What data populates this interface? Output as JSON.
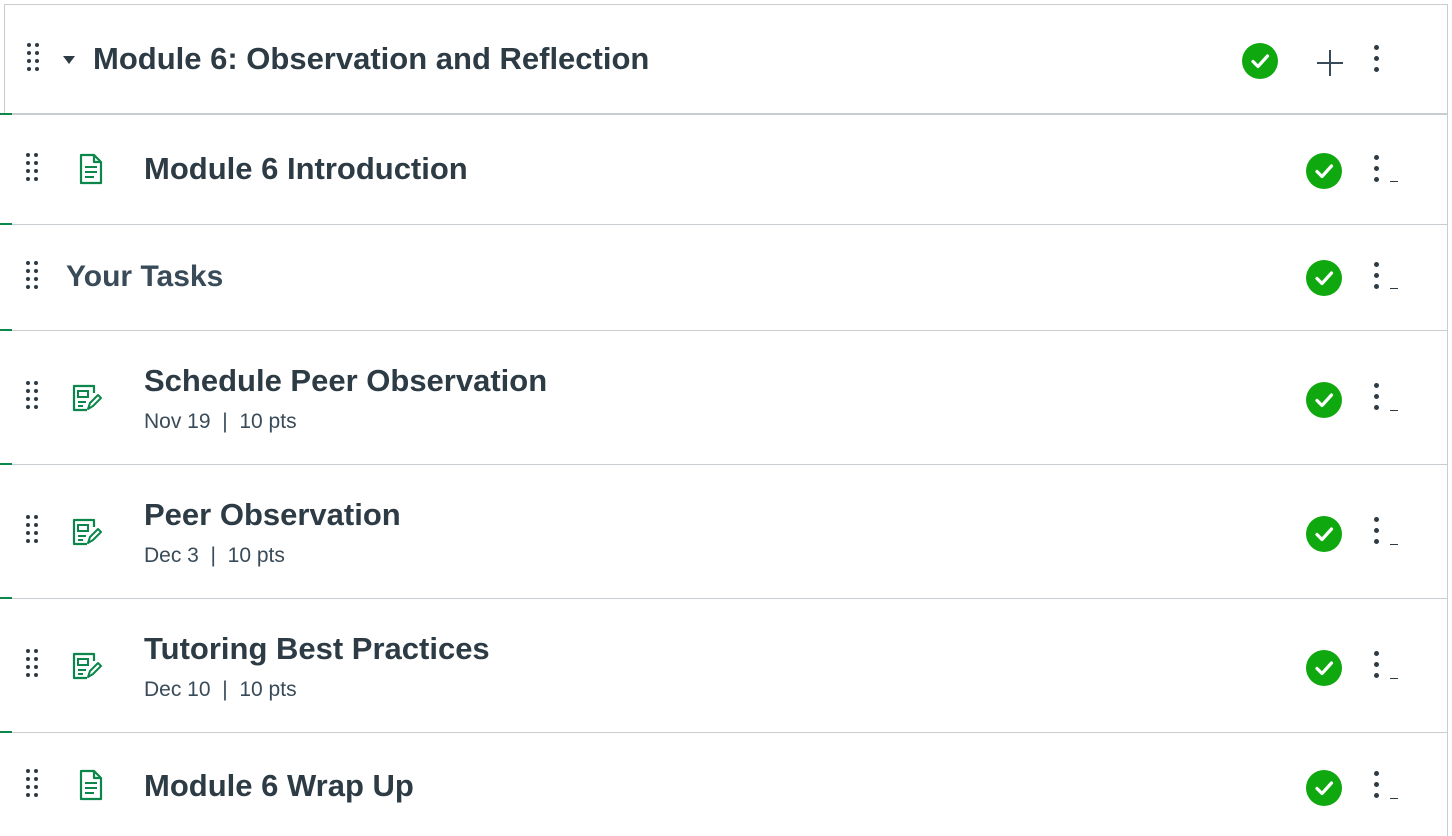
{
  "module": {
    "title": "Module 6: Observation and Reflection",
    "status": "published",
    "add_icon": "plus-icon",
    "menu_icon": "kebab-icon"
  },
  "items": [
    {
      "type": "page",
      "icon": "document-icon",
      "title": "Module 6 Introduction",
      "status": "published"
    },
    {
      "type": "subheader",
      "title": "Your Tasks",
      "status": "published"
    },
    {
      "type": "assignment",
      "icon": "assignment-icon",
      "title": "Schedule Peer Observation",
      "due": "Nov 19",
      "separator": "|",
      "points": "10 pts",
      "status": "published"
    },
    {
      "type": "assignment",
      "icon": "assignment-icon",
      "title": "Peer Observation",
      "due": "Dec 3",
      "separator": "|",
      "points": "10 pts",
      "status": "published"
    },
    {
      "type": "assignment",
      "icon": "assignment-icon",
      "title": "Tutoring Best Practices",
      "due": "Dec 10",
      "separator": "|",
      "points": "10 pts",
      "status": "published"
    },
    {
      "type": "page",
      "icon": "document-icon",
      "title": "Module 6 Wrap Up",
      "status": "published"
    }
  ],
  "colors": {
    "published_green": "#0fa80f",
    "icon_green": "#0b874b",
    "text": "#2d3b45",
    "border": "#c7cdd1"
  }
}
